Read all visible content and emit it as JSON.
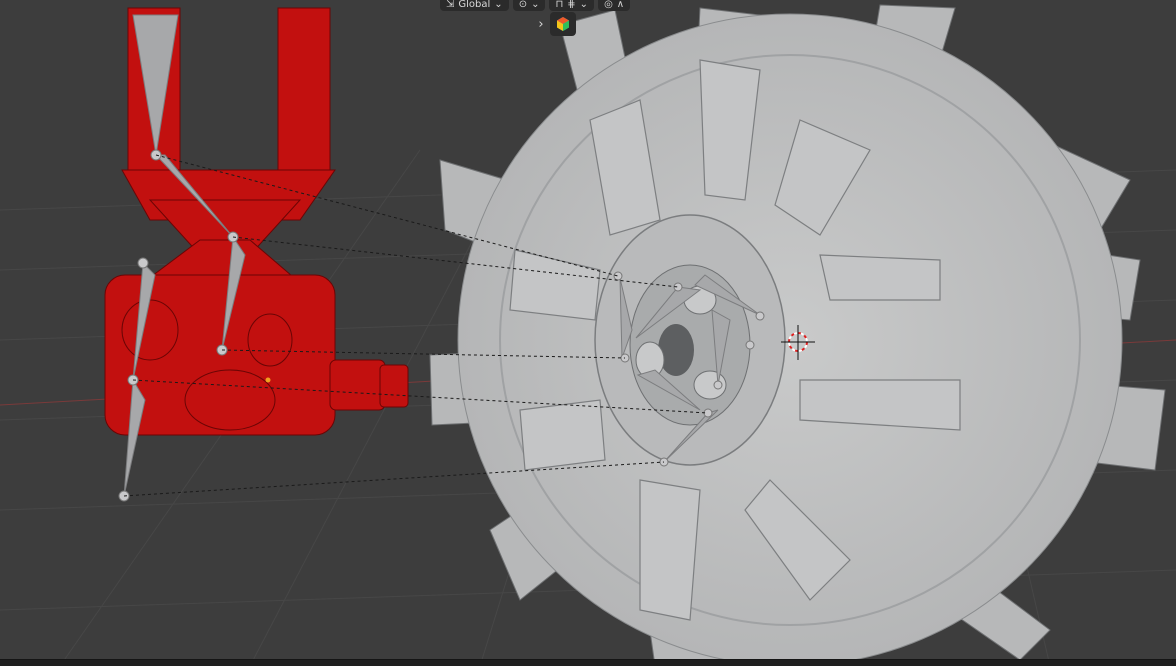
{
  "header": {
    "orientation": {
      "icon": "transform-orientation-icon",
      "label": "Global"
    },
    "pivot": {
      "icon": "pivot-icon"
    },
    "snap": {
      "icon": "snap-icon"
    },
    "proportional": {
      "icon": "proportional-edit-icon"
    }
  },
  "gizmo": {
    "expand_icon": "chevron-right-icon",
    "color_icon": "viewport-shading-icon"
  },
  "scene": {
    "colors": {
      "background": "#3d3d3d",
      "grid": "#4a4a4a",
      "gear": "#bfc0c2",
      "gear_dark": "#8f9193",
      "rig": "#c40f10",
      "bone": "#a8a9ab"
    }
  }
}
